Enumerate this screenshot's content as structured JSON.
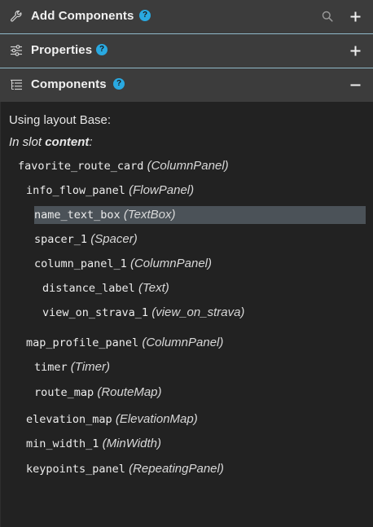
{
  "panels": {
    "add_components": {
      "title": "Add Components",
      "help": "?"
    },
    "properties": {
      "title": "Properties",
      "help": "?"
    },
    "components": {
      "title": "Components",
      "help": "?"
    }
  },
  "layout": {
    "using_layout": "Using layout Base:",
    "in_slot_prefix": "In slot ",
    "slot_name": "content",
    "slot_suffix": ":"
  },
  "tree": [
    {
      "name": "favorite_route_card",
      "type": "(ColumnPanel)",
      "depth": 0,
      "selected": false
    },
    {
      "name": "info_flow_panel",
      "type": "(FlowPanel)",
      "depth": 1,
      "selected": false
    },
    {
      "name": "name_text_box",
      "type": "(TextBox)",
      "depth": 2,
      "selected": true
    },
    {
      "name": "spacer_1",
      "type": "(Spacer)",
      "depth": 2,
      "selected": false
    },
    {
      "name": "column_panel_1",
      "type": "(ColumnPanel)",
      "depth": 2,
      "selected": false
    },
    {
      "name": "distance_label",
      "type": "(Text)",
      "depth": 3,
      "selected": false
    },
    {
      "name": "view_on_strava_1",
      "type": "(view_on_strava)",
      "depth": 3,
      "selected": false
    },
    {
      "name": "map_profile_panel",
      "type": "(ColumnPanel)",
      "depth": 1,
      "selected": false
    },
    {
      "name": "timer",
      "type": "(Timer)",
      "depth": 2,
      "selected": false
    },
    {
      "name": "route_map",
      "type": "(RouteMap)",
      "depth": 2,
      "selected": false
    },
    {
      "name": "elevation_map",
      "type": "(ElevationMap)",
      "depth": 1,
      "selected": false
    },
    {
      "name": "min_width_1",
      "type": "(MinWidth)",
      "depth": 1,
      "selected": false
    },
    {
      "name": "keypoints_panel",
      "type": "(RepeatingPanel)",
      "depth": 1,
      "selected": false
    }
  ],
  "icons": {
    "add_components": "wrench-icon",
    "properties": "sliders-icon",
    "components": "tree-list-icon",
    "search": "search-icon",
    "expand": "plus-icon",
    "collapse": "minus-icon"
  },
  "colors": {
    "header_bg": "#3c3c3c",
    "body_bg": "#222222",
    "help_badge": "#29a9e1",
    "selected_row": "#4b5258",
    "separator": "#8fb9c9"
  }
}
